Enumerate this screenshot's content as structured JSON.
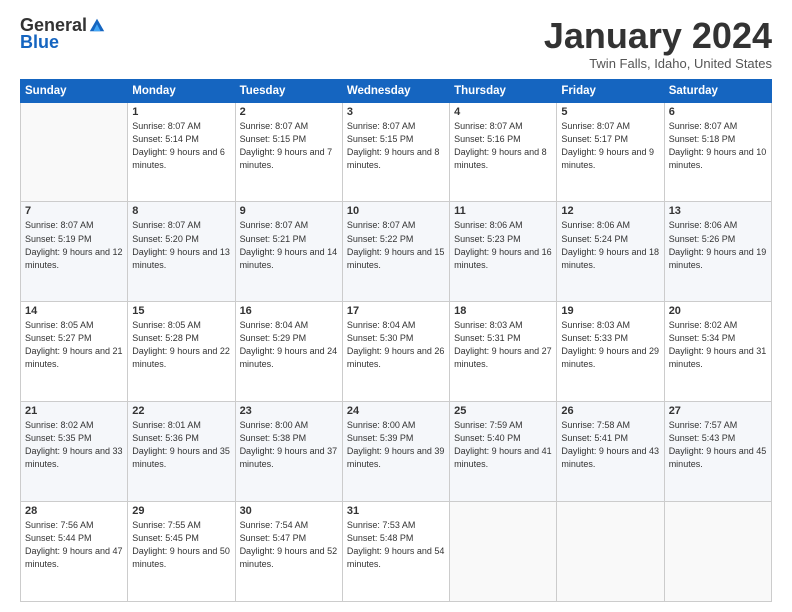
{
  "logo": {
    "general": "General",
    "blue": "Blue"
  },
  "header": {
    "title": "January 2024",
    "subtitle": "Twin Falls, Idaho, United States"
  },
  "weekdays": [
    "Sunday",
    "Monday",
    "Tuesday",
    "Wednesday",
    "Thursday",
    "Friday",
    "Saturday"
  ],
  "weeks": [
    [
      {
        "day": "",
        "sunrise": "",
        "sunset": "",
        "daylight": ""
      },
      {
        "day": "1",
        "sunrise": "Sunrise: 8:07 AM",
        "sunset": "Sunset: 5:14 PM",
        "daylight": "Daylight: 9 hours and 6 minutes."
      },
      {
        "day": "2",
        "sunrise": "Sunrise: 8:07 AM",
        "sunset": "Sunset: 5:15 PM",
        "daylight": "Daylight: 9 hours and 7 minutes."
      },
      {
        "day": "3",
        "sunrise": "Sunrise: 8:07 AM",
        "sunset": "Sunset: 5:15 PM",
        "daylight": "Daylight: 9 hours and 8 minutes."
      },
      {
        "day": "4",
        "sunrise": "Sunrise: 8:07 AM",
        "sunset": "Sunset: 5:16 PM",
        "daylight": "Daylight: 9 hours and 8 minutes."
      },
      {
        "day": "5",
        "sunrise": "Sunrise: 8:07 AM",
        "sunset": "Sunset: 5:17 PM",
        "daylight": "Daylight: 9 hours and 9 minutes."
      },
      {
        "day": "6",
        "sunrise": "Sunrise: 8:07 AM",
        "sunset": "Sunset: 5:18 PM",
        "daylight": "Daylight: 9 hours and 10 minutes."
      }
    ],
    [
      {
        "day": "7",
        "sunrise": "Sunrise: 8:07 AM",
        "sunset": "Sunset: 5:19 PM",
        "daylight": "Daylight: 9 hours and 12 minutes."
      },
      {
        "day": "8",
        "sunrise": "Sunrise: 8:07 AM",
        "sunset": "Sunset: 5:20 PM",
        "daylight": "Daylight: 9 hours and 13 minutes."
      },
      {
        "day": "9",
        "sunrise": "Sunrise: 8:07 AM",
        "sunset": "Sunset: 5:21 PM",
        "daylight": "Daylight: 9 hours and 14 minutes."
      },
      {
        "day": "10",
        "sunrise": "Sunrise: 8:07 AM",
        "sunset": "Sunset: 5:22 PM",
        "daylight": "Daylight: 9 hours and 15 minutes."
      },
      {
        "day": "11",
        "sunrise": "Sunrise: 8:06 AM",
        "sunset": "Sunset: 5:23 PM",
        "daylight": "Daylight: 9 hours and 16 minutes."
      },
      {
        "day": "12",
        "sunrise": "Sunrise: 8:06 AM",
        "sunset": "Sunset: 5:24 PM",
        "daylight": "Daylight: 9 hours and 18 minutes."
      },
      {
        "day": "13",
        "sunrise": "Sunrise: 8:06 AM",
        "sunset": "Sunset: 5:26 PM",
        "daylight": "Daylight: 9 hours and 19 minutes."
      }
    ],
    [
      {
        "day": "14",
        "sunrise": "Sunrise: 8:05 AM",
        "sunset": "Sunset: 5:27 PM",
        "daylight": "Daylight: 9 hours and 21 minutes."
      },
      {
        "day": "15",
        "sunrise": "Sunrise: 8:05 AM",
        "sunset": "Sunset: 5:28 PM",
        "daylight": "Daylight: 9 hours and 22 minutes."
      },
      {
        "day": "16",
        "sunrise": "Sunrise: 8:04 AM",
        "sunset": "Sunset: 5:29 PM",
        "daylight": "Daylight: 9 hours and 24 minutes."
      },
      {
        "day": "17",
        "sunrise": "Sunrise: 8:04 AM",
        "sunset": "Sunset: 5:30 PM",
        "daylight": "Daylight: 9 hours and 26 minutes."
      },
      {
        "day": "18",
        "sunrise": "Sunrise: 8:03 AM",
        "sunset": "Sunset: 5:31 PM",
        "daylight": "Daylight: 9 hours and 27 minutes."
      },
      {
        "day": "19",
        "sunrise": "Sunrise: 8:03 AM",
        "sunset": "Sunset: 5:33 PM",
        "daylight": "Daylight: 9 hours and 29 minutes."
      },
      {
        "day": "20",
        "sunrise": "Sunrise: 8:02 AM",
        "sunset": "Sunset: 5:34 PM",
        "daylight": "Daylight: 9 hours and 31 minutes."
      }
    ],
    [
      {
        "day": "21",
        "sunrise": "Sunrise: 8:02 AM",
        "sunset": "Sunset: 5:35 PM",
        "daylight": "Daylight: 9 hours and 33 minutes."
      },
      {
        "day": "22",
        "sunrise": "Sunrise: 8:01 AM",
        "sunset": "Sunset: 5:36 PM",
        "daylight": "Daylight: 9 hours and 35 minutes."
      },
      {
        "day": "23",
        "sunrise": "Sunrise: 8:00 AM",
        "sunset": "Sunset: 5:38 PM",
        "daylight": "Daylight: 9 hours and 37 minutes."
      },
      {
        "day": "24",
        "sunrise": "Sunrise: 8:00 AM",
        "sunset": "Sunset: 5:39 PM",
        "daylight": "Daylight: 9 hours and 39 minutes."
      },
      {
        "day": "25",
        "sunrise": "Sunrise: 7:59 AM",
        "sunset": "Sunset: 5:40 PM",
        "daylight": "Daylight: 9 hours and 41 minutes."
      },
      {
        "day": "26",
        "sunrise": "Sunrise: 7:58 AM",
        "sunset": "Sunset: 5:41 PM",
        "daylight": "Daylight: 9 hours and 43 minutes."
      },
      {
        "day": "27",
        "sunrise": "Sunrise: 7:57 AM",
        "sunset": "Sunset: 5:43 PM",
        "daylight": "Daylight: 9 hours and 45 minutes."
      }
    ],
    [
      {
        "day": "28",
        "sunrise": "Sunrise: 7:56 AM",
        "sunset": "Sunset: 5:44 PM",
        "daylight": "Daylight: 9 hours and 47 minutes."
      },
      {
        "day": "29",
        "sunrise": "Sunrise: 7:55 AM",
        "sunset": "Sunset: 5:45 PM",
        "daylight": "Daylight: 9 hours and 50 minutes."
      },
      {
        "day": "30",
        "sunrise": "Sunrise: 7:54 AM",
        "sunset": "Sunset: 5:47 PM",
        "daylight": "Daylight: 9 hours and 52 minutes."
      },
      {
        "day": "31",
        "sunrise": "Sunrise: 7:53 AM",
        "sunset": "Sunset: 5:48 PM",
        "daylight": "Daylight: 9 hours and 54 minutes."
      },
      {
        "day": "",
        "sunrise": "",
        "sunset": "",
        "daylight": ""
      },
      {
        "day": "",
        "sunrise": "",
        "sunset": "",
        "daylight": ""
      },
      {
        "day": "",
        "sunrise": "",
        "sunset": "",
        "daylight": ""
      }
    ]
  ]
}
